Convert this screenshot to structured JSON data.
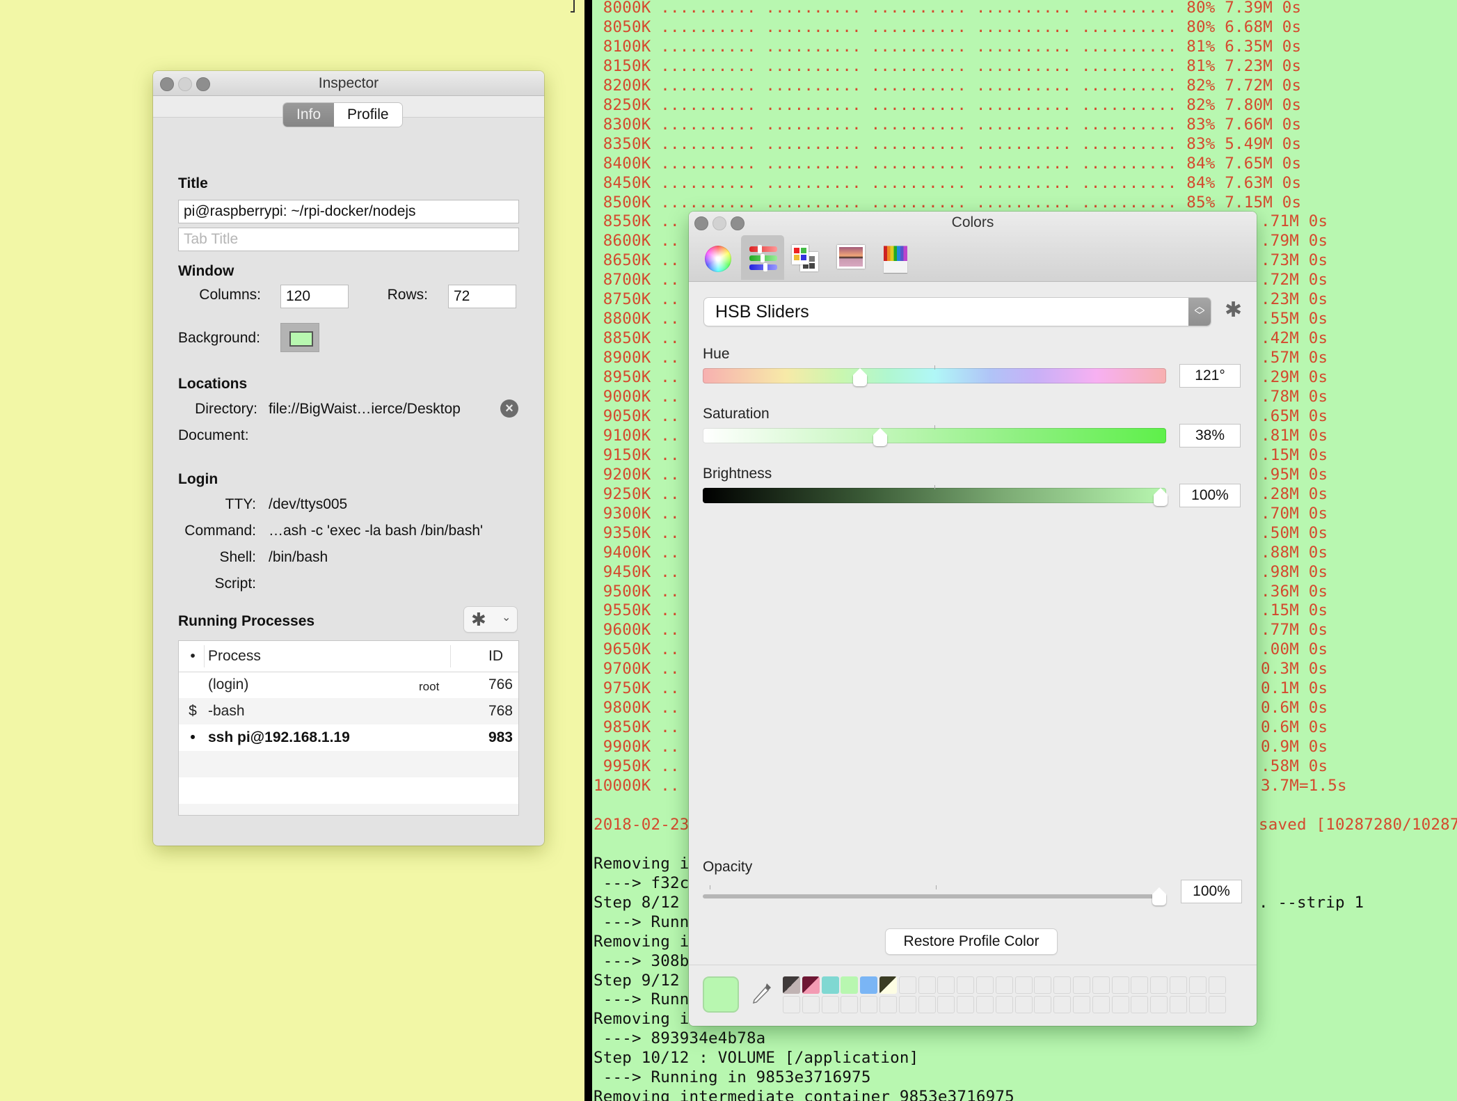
{
  "colors_theme": {
    "desktop": "#f2f7a6",
    "terminal_bg": "#b8f7b0",
    "terminal_fg_red": "#d44a2e",
    "terminal_fg_black": "#111111"
  },
  "terminal": {
    "progress_lines": [
      {
        "offset": "8000K",
        "dots": ".......... .......... .......... .......... ..........",
        "pct": "80%",
        "rate": "7.39M",
        "eta": "0s"
      },
      {
        "offset": "8050K",
        "dots": ".......... .......... .......... .......... ..........",
        "pct": "80%",
        "rate": "6.68M",
        "eta": "0s"
      },
      {
        "offset": "8100K",
        "dots": ".......... .......... .......... .......... ..........",
        "pct": "81%",
        "rate": "6.35M",
        "eta": "0s"
      },
      {
        "offset": "8150K",
        "dots": ".......... .......... .......... .......... ..........",
        "pct": "81%",
        "rate": "7.23M",
        "eta": "0s"
      },
      {
        "offset": "8200K",
        "dots": ".......... .......... .......... .......... ..........",
        "pct": "82%",
        "rate": "7.72M",
        "eta": "0s"
      },
      {
        "offset": "8250K",
        "dots": ".......... .......... .......... .......... ..........",
        "pct": "82%",
        "rate": "7.80M",
        "eta": "0s"
      },
      {
        "offset": "8300K",
        "dots": ".......... .......... .......... .......... ..........",
        "pct": "83%",
        "rate": "7.66M",
        "eta": "0s"
      },
      {
        "offset": "8350K",
        "dots": ".......... .......... .......... .......... ..........",
        "pct": "83%",
        "rate": "5.49M",
        "eta": "0s"
      },
      {
        "offset": "8400K",
        "dots": ".......... .......... .......... .......... ..........",
        "pct": "84%",
        "rate": "7.65M",
        "eta": "0s"
      },
      {
        "offset": "8450K",
        "dots": ".......... .......... .......... .......... ..........",
        "pct": "84%",
        "rate": "7.63M",
        "eta": "0s"
      },
      {
        "offset": "8500K",
        "dots": ".......... .......... .......... .......... ..........",
        "pct": "85%",
        "rate": "7.15M",
        "eta": "0s"
      }
    ],
    "partial_lines": [
      {
        "left": "8550K ..",
        "right": ".71M 0s"
      },
      {
        "left": "8600K ..",
        "right": ".79M 0s"
      },
      {
        "left": "8650K ..",
        "right": ".73M 0s"
      },
      {
        "left": "8700K ..",
        "right": ".72M 0s"
      },
      {
        "left": "8750K ..",
        "right": ".23M 0s"
      },
      {
        "left": "8800K ..",
        "right": ".55M 0s"
      },
      {
        "left": "8850K ..",
        "right": ".42M 0s"
      },
      {
        "left": "8900K ..",
        "right": ".57M 0s"
      },
      {
        "left": "8950K ..",
        "right": ".29M 0s"
      },
      {
        "left": "9000K ..",
        "right": ".78M 0s"
      },
      {
        "left": "9050K ..",
        "right": ".65M 0s"
      },
      {
        "left": "9100K ..",
        "right": ".81M 0s"
      },
      {
        "left": "9150K ..",
        "right": ".15M 0s"
      },
      {
        "left": "9200K ..",
        "right": ".95M 0s"
      },
      {
        "left": "9250K ..",
        "right": ".28M 0s"
      },
      {
        "left": "9300K ..",
        "right": ".70M 0s"
      },
      {
        "left": "9350K ..",
        "right": ".50M 0s"
      },
      {
        "left": "9400K ..",
        "right": ".88M 0s"
      },
      {
        "left": "9450K ..",
        "right": ".98M 0s"
      },
      {
        "left": "9500K ..",
        "right": ".36M 0s"
      },
      {
        "left": "9550K ..",
        "right": ".15M 0s"
      },
      {
        "left": "9600K ..",
        "right": ".77M 0s"
      },
      {
        "left": "9650K ..",
        "right": ".00M 0s"
      },
      {
        "left": "9700K ..",
        "right": "0.3M 0s"
      },
      {
        "left": "9750K ..",
        "right": "0.1M 0s"
      },
      {
        "left": "9800K ..",
        "right": "0.6M 0s"
      },
      {
        "left": "9850K ..",
        "right": "0.6M 0s"
      },
      {
        "left": "9900K ..",
        "right": "0.9M 0s"
      },
      {
        "left": "9950K ..",
        "right": ".58M 0s"
      },
      {
        "left": "10000K ..",
        "right": "3.7M=1.5s"
      }
    ],
    "tail_lines": [
      {
        "left": "",
        "right": "",
        "color": "red"
      },
      {
        "left": "2018-02-23",
        "right": "saved [10287280/10287",
        "color": "red"
      },
      {
        "left": "",
        "right": "",
        "color": "black"
      },
      {
        "left": "Removing i",
        "right": "",
        "color": "black"
      },
      {
        "left": " ---> f32c",
        "right": "",
        "color": "black"
      },
      {
        "left": "Step 8/12",
        "right": ". --strip 1",
        "color": "black"
      },
      {
        "left": " ---> Runn",
        "right": "",
        "color": "black"
      },
      {
        "left": "Removing i",
        "right": "",
        "color": "black"
      },
      {
        "left": " ---> 308b",
        "right": "",
        "color": "black"
      },
      {
        "left": "Step 9/12",
        "right": "",
        "color": "black"
      },
      {
        "left": " ---> Runn",
        "right": "",
        "color": "black"
      },
      {
        "left": "Removing i",
        "right": "",
        "color": "black"
      },
      {
        "left": " ---> 893934e4b78a",
        "right": "",
        "color": "black"
      },
      {
        "left": "Step 10/12 : VOLUME [/application]",
        "right": "",
        "color": "black"
      },
      {
        "left": " ---> Running in 9853e3716975",
        "right": "",
        "color": "black"
      },
      {
        "left": "Removing intermediate container 9853e3716975",
        "right": "",
        "color": "black"
      }
    ]
  },
  "inspector": {
    "title": "Inspector",
    "tabs": [
      {
        "label": "Info",
        "selected": true
      },
      {
        "label": "Profile",
        "selected": false
      }
    ],
    "title_section": {
      "heading": "Title",
      "window_title_value": "pi@raspberrypi: ~/rpi-docker/nodejs",
      "tab_title_placeholder": "Tab Title"
    },
    "window_section": {
      "heading": "Window",
      "columns_label": "Columns:",
      "columns_value": "120",
      "rows_label": "Rows:",
      "rows_value": "72",
      "background_label": "Background:",
      "background_color": "#b8f7b0"
    },
    "locations": {
      "heading": "Locations",
      "directory_label": "Directory:",
      "directory_value": "file://BigWaist…ierce/Desktop",
      "document_label": "Document:",
      "document_value": ""
    },
    "login": {
      "heading": "Login",
      "tty_label": "TTY:",
      "tty_value": "/dev/ttys005",
      "command_label": "Command:",
      "command_value": "…ash -c 'exec -la bash /bin/bash'",
      "shell_label": "Shell:",
      "shell_value": "/bin/bash",
      "script_label": "Script:",
      "script_value": ""
    },
    "processes": {
      "heading": "Running Processes",
      "columns": {
        "marker": "•",
        "process": "Process",
        "id": "ID"
      },
      "rows": [
        {
          "marker": "",
          "name": "(login)",
          "user": "root",
          "id": "766",
          "bold": false
        },
        {
          "marker": "$",
          "name": "-bash",
          "user": "",
          "id": "768",
          "bold": false
        },
        {
          "marker": "•",
          "name": "ssh pi@192.168.1.19",
          "user": "",
          "id": "983",
          "bold": true
        }
      ]
    }
  },
  "colors_panel": {
    "title": "Colors",
    "modes": [
      "color-wheel",
      "color-sliders",
      "color-palettes",
      "image-palettes",
      "pencils"
    ],
    "selected_mode": "color-sliders",
    "slider_type": "HSB Sliders",
    "sliders": [
      {
        "label": "Hue",
        "display": "121°",
        "value_fraction": 0.336
      },
      {
        "label": "Saturation",
        "display": "38%",
        "value_fraction": 0.38
      },
      {
        "label": "Brightness",
        "display": "100%",
        "value_fraction": 1.0
      }
    ],
    "opacity": {
      "label": "Opacity",
      "display": "100%",
      "value_fraction": 1.0
    },
    "restore_button": "Restore Profile Color",
    "current_color": "#b8f7b0",
    "swatches": [
      {
        "type": "split",
        "a": "#3f3a3a",
        "b": "#c0b3b3"
      },
      {
        "type": "split",
        "a": "#6e1734",
        "b": "#f39bb3"
      },
      {
        "type": "solid",
        "a": "#7fd8d2"
      },
      {
        "type": "solid",
        "a": "#b8f7b0"
      },
      {
        "type": "solid",
        "a": "#7ab5f5"
      },
      {
        "type": "split",
        "a": "#3a3c24",
        "b": "#fdfde3"
      }
    ],
    "swatch_columns": 23,
    "swatch_rows": 2
  }
}
